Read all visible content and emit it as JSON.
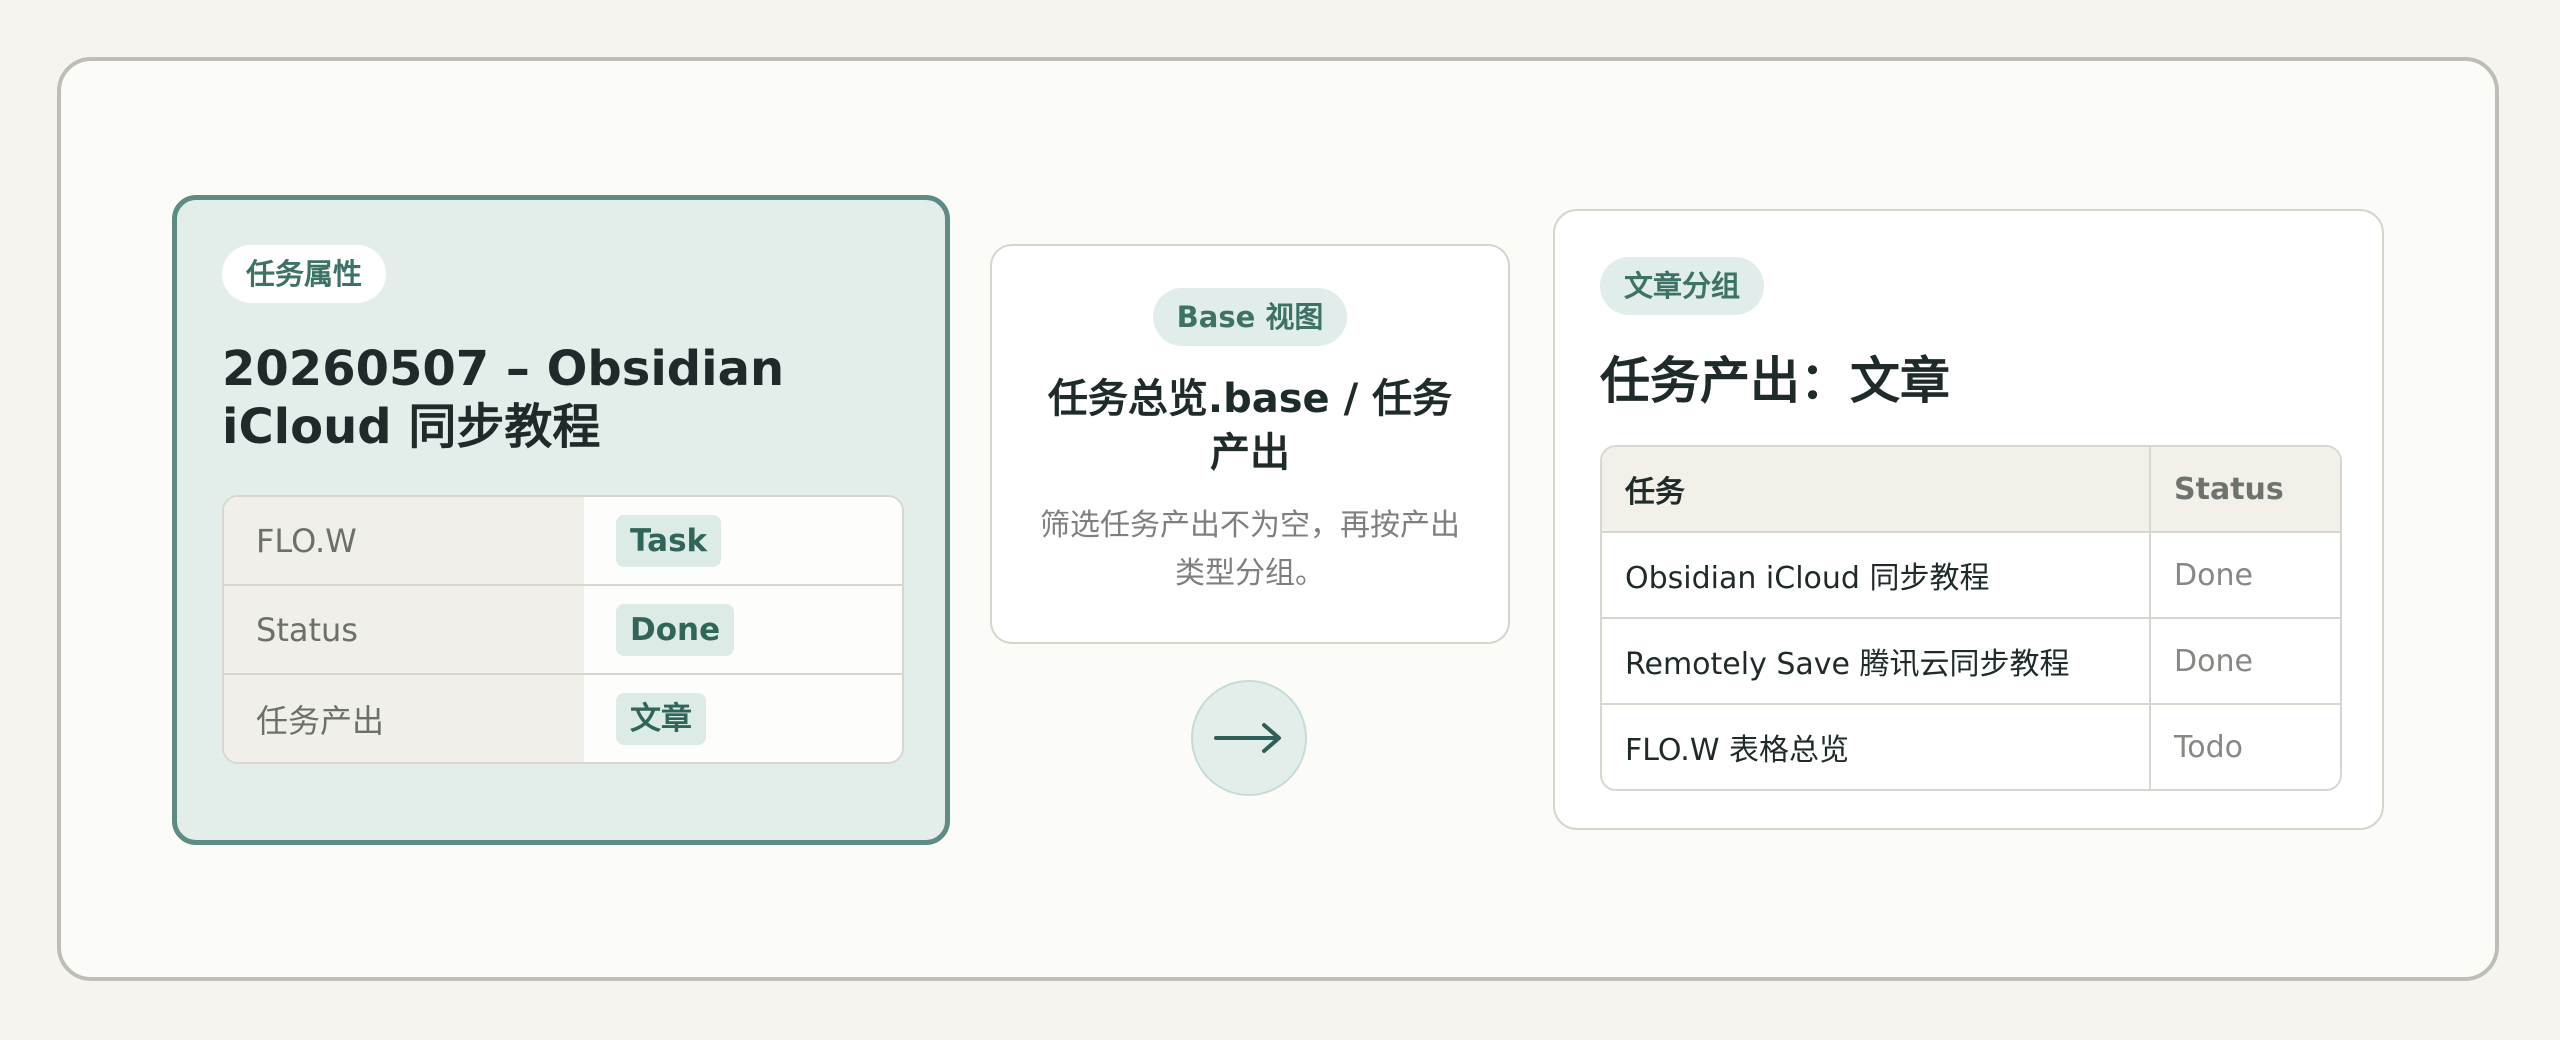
{
  "left_card": {
    "badge": "任务属性",
    "title": "20260507 – Obsidian iCloud 同步教程",
    "properties": [
      {
        "key": "FLO.W",
        "value": "Task"
      },
      {
        "key": "Status",
        "value": "Done"
      },
      {
        "key": "任务产出",
        "value": "文章"
      }
    ]
  },
  "middle_card": {
    "badge": "Base 视图",
    "title": "任务总览.base / 任务产出",
    "subtitle": "筛选任务产出不为空，再按产出类型分组。",
    "arrow_icon": "arrow-right-icon"
  },
  "right_card": {
    "badge": "文章分组",
    "title": "任务产出：文章",
    "table": {
      "headers": [
        "任务",
        "Status"
      ],
      "rows": [
        [
          "Obsidian iCloud 同步教程",
          "Done"
        ],
        [
          "Remotely Save 腾讯云同步教程",
          "Done"
        ],
        [
          "FLO.W 表格总览",
          "Todo"
        ]
      ]
    }
  },
  "colors": {
    "accent": "#5e8c84",
    "accent_light": "#e3eeeb",
    "tag_text": "#2f6659"
  }
}
